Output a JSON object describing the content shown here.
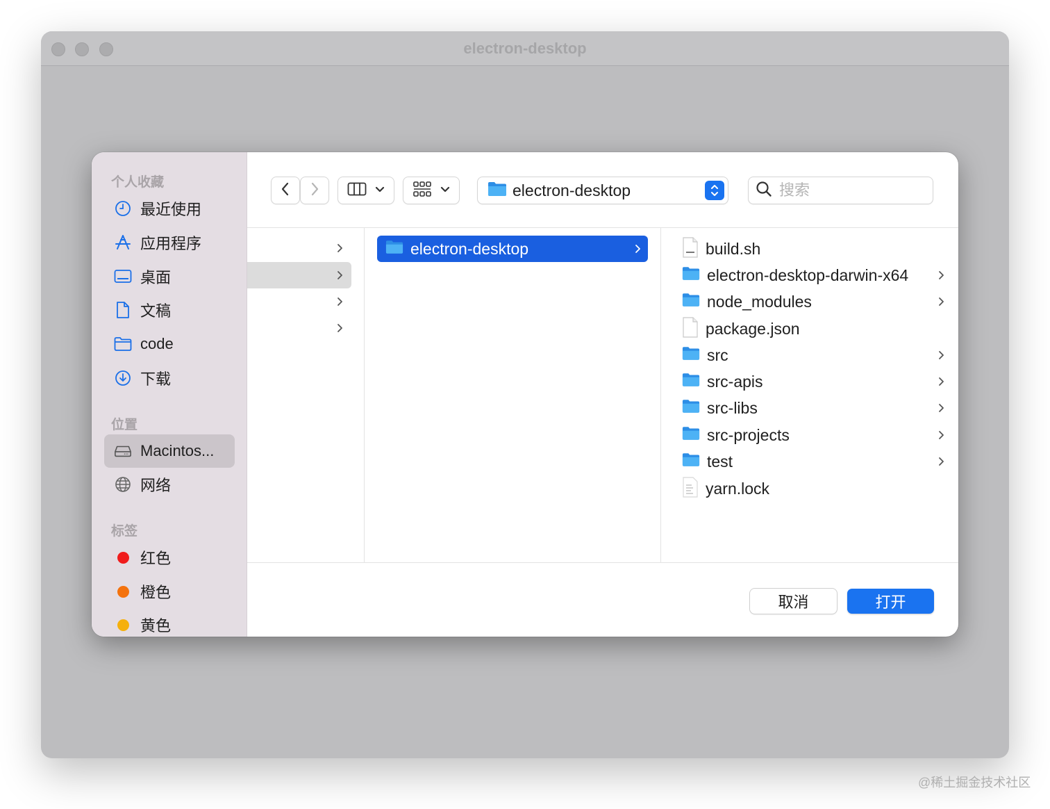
{
  "window": {
    "title": "electron-desktop"
  },
  "sidebar": {
    "sections": [
      {
        "title": "个人收藏"
      },
      {
        "title": "位置"
      },
      {
        "title": "标签"
      }
    ],
    "favorites": [
      {
        "label": "最近使用",
        "icon": "clock-icon"
      },
      {
        "label": "应用程序",
        "icon": "applications-icon"
      },
      {
        "label": "桌面",
        "icon": "desktop-icon"
      },
      {
        "label": "文稿",
        "icon": "document-icon"
      },
      {
        "label": "code",
        "icon": "folder-icon"
      },
      {
        "label": "下载",
        "icon": "download-icon"
      }
    ],
    "locations": [
      {
        "label": "Macintos...",
        "icon": "disk-icon",
        "selected": true
      },
      {
        "label": "网络",
        "icon": "network-icon"
      }
    ],
    "tags": [
      {
        "label": "红色",
        "color": "#f01c1c"
      },
      {
        "label": "橙色",
        "color": "#f4720d"
      },
      {
        "label": "黄色",
        "color": "#f5b00c"
      }
    ]
  },
  "toolbar": {
    "path": "electron-desktop",
    "search_placeholder": "搜索"
  },
  "columns": {
    "selected_folder": "electron-desktop",
    "contents": [
      {
        "name": "build.sh",
        "type": "shell"
      },
      {
        "name": "electron-desktop-darwin-x64",
        "type": "folder"
      },
      {
        "name": "node_modules",
        "type": "folder"
      },
      {
        "name": "package.json",
        "type": "file"
      },
      {
        "name": "src",
        "type": "folder"
      },
      {
        "name": "src-apis",
        "type": "folder"
      },
      {
        "name": "src-libs",
        "type": "folder"
      },
      {
        "name": "src-projects",
        "type": "folder"
      },
      {
        "name": "test",
        "type": "folder"
      },
      {
        "name": "yarn.lock",
        "type": "text"
      }
    ]
  },
  "buttons": {
    "cancel": "取消",
    "open": "打开"
  },
  "watermark": "@稀土掘金技术社区",
  "colors": {
    "accent": "#1a73f0",
    "selection": "#1a5fe0",
    "folder": "#3fa7ee"
  }
}
